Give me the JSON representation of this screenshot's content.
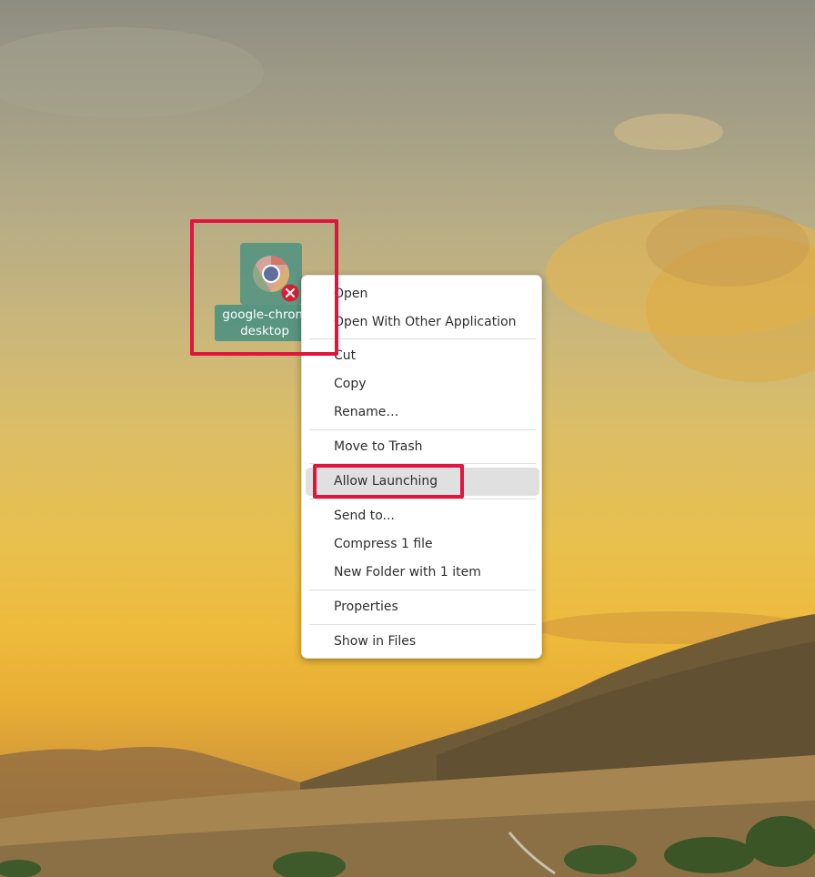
{
  "desktop": {
    "icon": {
      "name": "chrome-icon",
      "badge": "error-badge-icon",
      "label_line1": "google-chrom",
      "label_line2": "desktop"
    }
  },
  "context_menu": {
    "items": [
      {
        "label": "Open"
      },
      {
        "label": "Open With Other Application"
      },
      {
        "label": "Cut"
      },
      {
        "label": "Copy"
      },
      {
        "label": "Rename…"
      },
      {
        "label": "Move to Trash"
      },
      {
        "label": "Allow Launching"
      },
      {
        "label": "Send to..."
      },
      {
        "label": "Compress 1 file"
      },
      {
        "label": "New Folder with 1 item"
      },
      {
        "label": "Properties"
      },
      {
        "label": "Show in Files"
      }
    ],
    "hovered_item": "Allow Launching"
  },
  "colors": {
    "highlight": "#e0143c",
    "icon_tile": "#3f8e82",
    "menu_background": "#ffffff",
    "hover_background": "#e0e0e0"
  }
}
